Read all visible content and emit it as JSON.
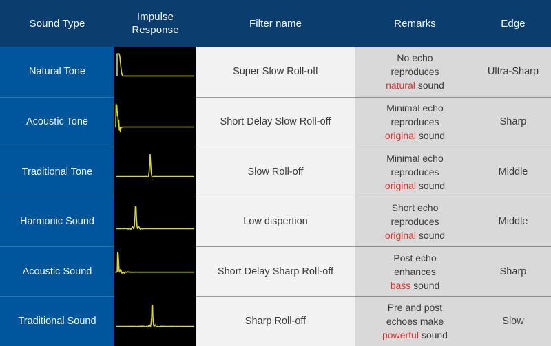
{
  "header": {
    "columns": [
      {
        "label": "Sound Type",
        "lines": [
          "Sound Type"
        ]
      },
      {
        "label": "Impulse Response",
        "lines": [
          "Impulse",
          "Response"
        ]
      },
      {
        "label": "Filter name",
        "lines": [
          "Filter name"
        ]
      },
      {
        "label": "Remarks",
        "lines": [
          "Remarks"
        ]
      },
      {
        "label": "Edge",
        "lines": [
          "Edge"
        ]
      }
    ]
  },
  "colors": {
    "header_blue": "#0b3d6e",
    "sound_type_blue": "#00569b",
    "impulse_black": "#000000",
    "waveform_yellow": "#d8d838",
    "filter_gray": "#f2f2f2",
    "remarks_gray": "#d9d9d9",
    "highlight_red": "#e03030",
    "text_dark": "#3b3b3b"
  },
  "rows": [
    {
      "sound_type": "Natural Tone",
      "impulse": "step-decay-no-ringing",
      "filter_name": "Super Slow Roll-off",
      "remarks_lines": [
        "No echo",
        "reproduces",
        ""
      ],
      "remarks_highlight": "natural",
      "remarks_highlight_suffix": " sound",
      "edge": "Ultra-Sharp"
    },
    {
      "sound_type": "Acoustic Tone",
      "impulse": "leading-spike-flat-tail",
      "filter_name": "Short Delay Slow Roll-off",
      "remarks_lines": [
        "Minimal echo",
        "reproduces",
        ""
      ],
      "remarks_highlight": "original",
      "remarks_highlight_suffix": " sound",
      "edge": "Sharp"
    },
    {
      "sound_type": "Traditional Tone",
      "impulse": "centered-single-spike",
      "filter_name": "Slow Roll-off",
      "remarks_lines": [
        "Minimal echo",
        "reproduces",
        ""
      ],
      "remarks_highlight": "original",
      "remarks_highlight_suffix": " sound",
      "edge": "Middle"
    },
    {
      "sound_type": "Harmonic Sound",
      "impulse": "short-ringing-both-sides",
      "filter_name": "Low dispertion",
      "remarks_lines": [
        "Short echo",
        "reproduces",
        ""
      ],
      "remarks_highlight": "original",
      "remarks_highlight_suffix": " sound",
      "edge": "Middle"
    },
    {
      "sound_type": "Acoustic Sound",
      "impulse": "post-ringing-decay",
      "filter_name": "Short Delay Sharp Roll-off",
      "remarks_lines": [
        "Post echo",
        "enhances",
        ""
      ],
      "remarks_highlight": "bass",
      "remarks_highlight_suffix": " sound",
      "edge": "Sharp"
    },
    {
      "sound_type": "Traditional Sound",
      "impulse": "pre-and-post-ringing",
      "filter_name": "Sharp Roll-off",
      "remarks_lines": [
        "Pre and post",
        "echoes make",
        ""
      ],
      "remarks_highlight": "powerful",
      "remarks_highlight_suffix": " sound",
      "edge": "Slow"
    }
  ]
}
